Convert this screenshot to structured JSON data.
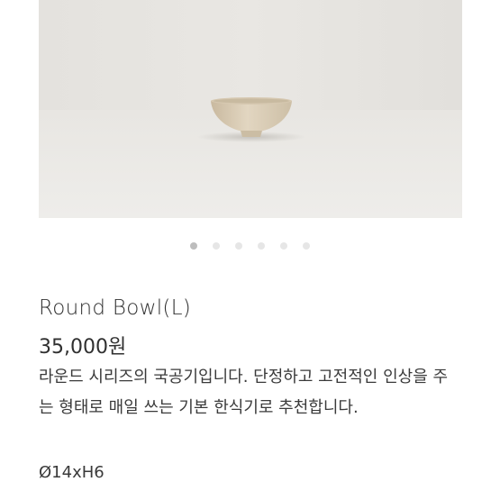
{
  "product": {
    "image_alt_icon": "bowl-photo",
    "title": "Round Bowl(L)",
    "price": "35,000원",
    "description": "라운드 시리즈의 국공기입니다. 단정하고 고전적인 인상을 주는 형태로 매일 쓰는 기본 한식기로 추천합니다.",
    "dimensions": "Ø14xH6"
  },
  "carousel": {
    "total": 6,
    "active_index": 0
  },
  "colors": {
    "bowl": "#d9cbb3",
    "dot_active": "#bdbdbd",
    "dot_inactive": "#e6e6e6"
  }
}
